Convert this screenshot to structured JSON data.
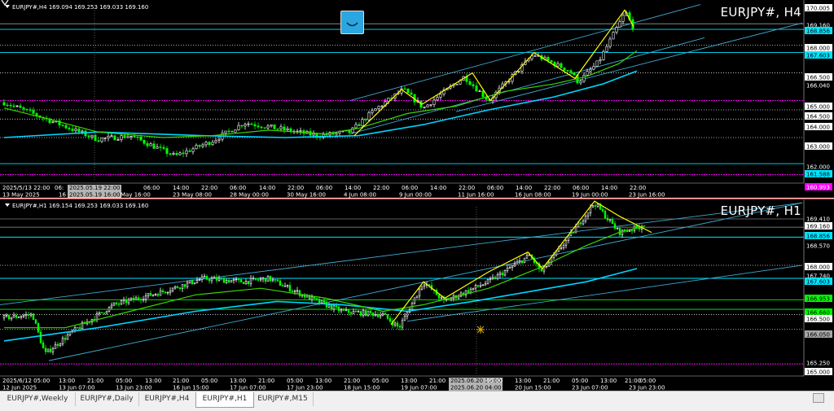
{
  "pane_top": {
    "header": "EURJPY#,H4  169.094 169.253 169.033 169.160",
    "symbol_label": "EURJPY#, H4",
    "price_labels": [
      {
        "text": "170.005",
        "style": "white"
      },
      {
        "text": "169.160",
        "style": "plain"
      },
      {
        "text": "168.856",
        "style": "cyan"
      },
      {
        "text": "168.000",
        "style": "white"
      },
      {
        "text": "167.603",
        "style": "cyan"
      },
      {
        "text": "166.500",
        "style": "white"
      },
      {
        "text": "166.040",
        "style": "plain"
      },
      {
        "text": "165.000",
        "style": "white"
      },
      {
        "text": "164.500",
        "style": "white"
      },
      {
        "text": "164.000",
        "style": "white"
      },
      {
        "text": "163.000",
        "style": "white"
      },
      {
        "text": "162.000",
        "style": "plain"
      },
      {
        "text": "161.588",
        "style": "cyan"
      },
      {
        "text": "160.993",
        "style": "magenta"
      }
    ],
    "time_row1": [
      "2025/5/13 22:00",
      "06:",
      "2025.05.19 22:00",
      "06:00",
      "14:00",
      "22:00",
      "06:00",
      "14:00",
      "22:00",
      "06:00",
      "14:00",
      "22:00",
      "06:00",
      "14:00",
      "22:00",
      "06:00",
      "14:00",
      "22:00",
      "06:00",
      "14:00",
      "22:00"
    ],
    "time_row2": [
      "13 May 2025",
      "16",
      "2025.05.19 16:00",
      "May 16:00",
      "23 May 08:00",
      "28 May 00:00",
      "30 May 16:00",
      "4 Jun 08:00",
      "9 Jun 00:00",
      "11 Jun 16:00",
      "16 Jun 08:00",
      "19 Jun 00:00",
      "23 Jun 16:00"
    ]
  },
  "pane_bottom": {
    "header": "EURJPY#,H1  169.154 169.253 169.033 169.160",
    "symbol_label": "EURJPY#, H1",
    "price_labels": [
      {
        "text": "169.410",
        "style": "plain"
      },
      {
        "text": "169.160",
        "style": "white"
      },
      {
        "text": "168.856",
        "style": "cyan"
      },
      {
        "text": "168.570",
        "style": "plain"
      },
      {
        "text": "168.000",
        "style": "white"
      },
      {
        "text": "167.740",
        "style": "plain"
      },
      {
        "text": "167.603",
        "style": "cyan"
      },
      {
        "text": "166.953",
        "style": "green"
      },
      {
        "text": "166.660",
        "style": "green"
      },
      {
        "text": "166.500",
        "style": "white"
      },
      {
        "text": "166.050",
        "style": "grey"
      },
      {
        "text": "165.250",
        "style": "plain"
      },
      {
        "text": "165.000",
        "style": "white"
      }
    ],
    "time_row1": [
      "2025/6/12 05:00",
      "13:00",
      "21:00",
      "05:00",
      "13:00",
      "21:00",
      "05:00",
      "13:00",
      "21:00",
      "05:00",
      "13:00",
      "21:00",
      "05:00",
      "13:00",
      "21:00",
      "2025.06.20 10:00",
      "05:00",
      "13:00",
      "21:00",
      "05:00",
      "13:00",
      "21:00",
      "05:00"
    ],
    "time_row2": [
      "12 Jun 2025",
      "13 Jun 07:00",
      "13 Jun 23:00",
      "16 Jun 15:00",
      "17 Jun 07:00",
      "17 Jun 23:00",
      "18 Jun 15:00",
      "19 Jun 07:00",
      "2025.06.20 04:00",
      "20 Jun 15:00",
      "23 Jun 07:00",
      "23 Jun 23:00"
    ]
  },
  "tabs": [
    {
      "label": "EURJPY#,Weekly",
      "active": false
    },
    {
      "label": "EURJPY#,Daily",
      "active": false
    },
    {
      "label": "EURJPY#,H4",
      "active": false
    },
    {
      "label": "EURJPY#,H1",
      "active": true
    },
    {
      "label": "EURJPY#,M15",
      "active": false
    }
  ],
  "colors": {
    "background": "#000000",
    "bull_candle": "#ffffff",
    "bear_candle": "#00ff00",
    "zigzag": "#ffff00",
    "ma_fast": "#39d600",
    "ma_slow": "#00d4ff",
    "channel": "#3fa9d4",
    "pink_level": "#ff00ff",
    "red_level": "#ff0000"
  },
  "icons": {
    "logo": "app-logo-icon",
    "crosshair": "crosshair-marker-icon"
  }
}
